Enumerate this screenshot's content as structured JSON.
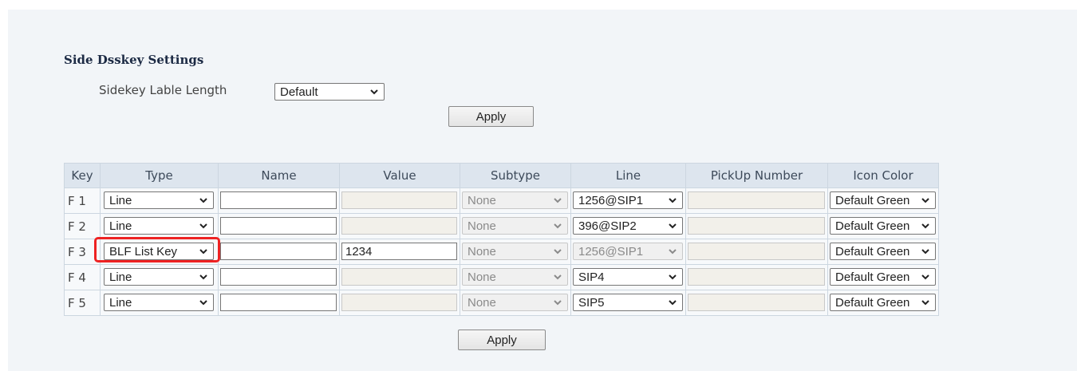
{
  "section": {
    "title": "Side Dsskey Settings",
    "label_length_label": "Sidekey Lable Length",
    "label_length_value": "Default",
    "apply_label": "Apply"
  },
  "table": {
    "headers": [
      "Key",
      "Type",
      "Name",
      "Value",
      "Subtype",
      "Line",
      "PickUp Number",
      "Icon Color"
    ],
    "rows": [
      {
        "key": "F 1",
        "type": "Line",
        "name": "",
        "value": "",
        "subtype": "None",
        "line": "1256@SIP1",
        "pickup": "",
        "icon_color": "Default Green"
      },
      {
        "key": "F 2",
        "type": "Line",
        "name": "",
        "value": "",
        "subtype": "None",
        "line": "396@SIP2",
        "pickup": "",
        "icon_color": "Default Green"
      },
      {
        "key": "F 3",
        "type": "BLF List Key",
        "name": "",
        "value": "1234",
        "subtype": "None",
        "line": "1256@SIP1",
        "pickup": "",
        "icon_color": "Default Green"
      },
      {
        "key": "F 4",
        "type": "Line",
        "name": "",
        "value": "",
        "subtype": "None",
        "line": "SIP4",
        "pickup": "",
        "icon_color": "Default Green"
      },
      {
        "key": "F 5",
        "type": "Line",
        "name": "",
        "value": "",
        "subtype": "None",
        "line": "SIP5",
        "pickup": "",
        "icon_color": "Default Green"
      }
    ]
  },
  "footer": {
    "apply_label": "Apply"
  },
  "colors": {
    "highlight": "#ee2222",
    "header_bg": "#dde5ee",
    "panel_bg": "#f2f5f8"
  }
}
